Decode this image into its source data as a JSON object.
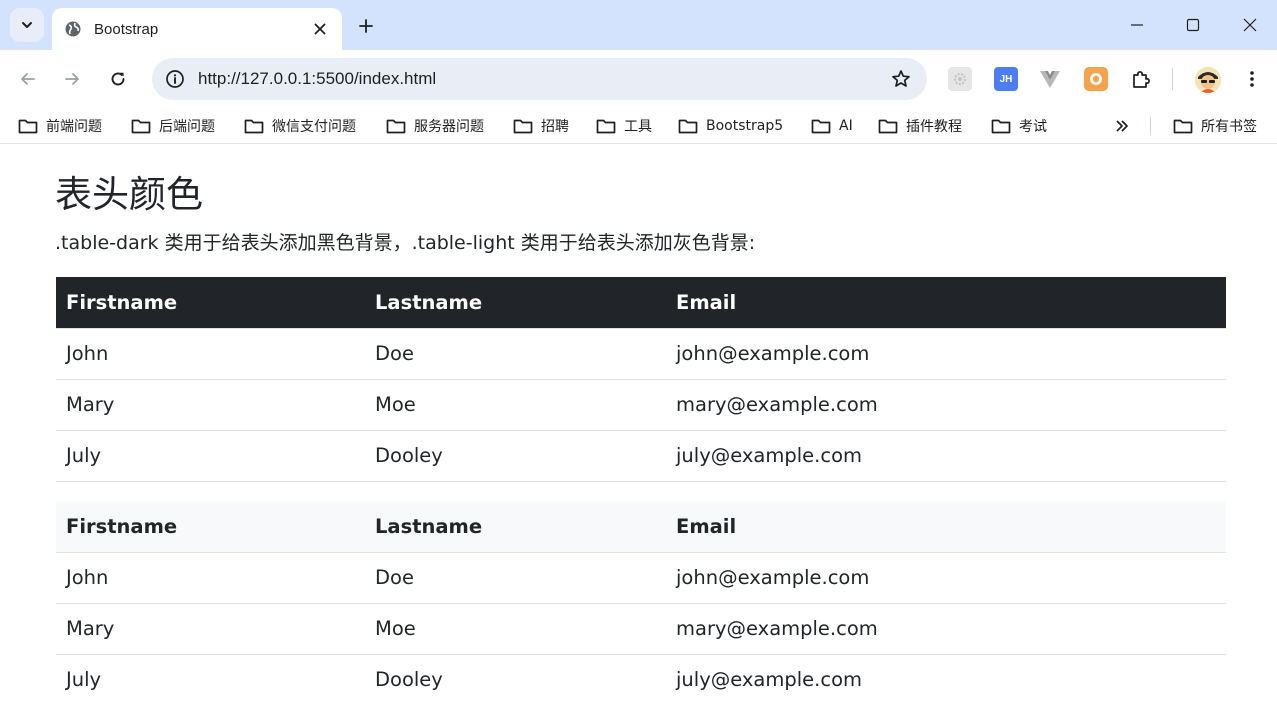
{
  "browser": {
    "tab_title": "Bootstrap",
    "url": "http://127.0.0.1:5500/index.html",
    "extensions": [
      "gear-extension-icon",
      "JH",
      "vue-extension-icon",
      "orange-extension-icon",
      "puzzle-icon"
    ],
    "jh_label": "JH",
    "bookmarks": [
      {
        "label": "前端问题"
      },
      {
        "label": "后端问题"
      },
      {
        "label": "微信支付问题"
      },
      {
        "label": "服务器问题"
      },
      {
        "label": "招聘"
      },
      {
        "label": "工具"
      },
      {
        "label": "Bootstrap5"
      },
      {
        "label": "AI"
      },
      {
        "label": "插件教程"
      },
      {
        "label": "考试"
      }
    ],
    "all_bookmarks_label": "所有书签"
  },
  "page": {
    "title": "表头颜色",
    "description": ".table-dark 类用于给表头添加黑色背景，.table-light 类用于给表头添加灰色背景:",
    "tables": [
      {
        "variant": "dark",
        "headers": [
          "Firstname",
          "Lastname",
          "Email"
        ],
        "rows": [
          [
            "John",
            "Doe",
            "john@example.com"
          ],
          [
            "Mary",
            "Moe",
            "mary@example.com"
          ],
          [
            "July",
            "Dooley",
            "july@example.com"
          ]
        ]
      },
      {
        "variant": "light",
        "headers": [
          "Firstname",
          "Lastname",
          "Email"
        ],
        "rows": [
          [
            "John",
            "Doe",
            "john@example.com"
          ],
          [
            "Mary",
            "Moe",
            "mary@example.com"
          ],
          [
            "July",
            "Dooley",
            "july@example.com"
          ]
        ]
      }
    ]
  },
  "colors": {
    "tabstrip": "#d3e3fd",
    "omnibox": "#e9eef6",
    "dark_header": "#212529",
    "light_header": "#f8f9fa",
    "text": "#212529"
  }
}
